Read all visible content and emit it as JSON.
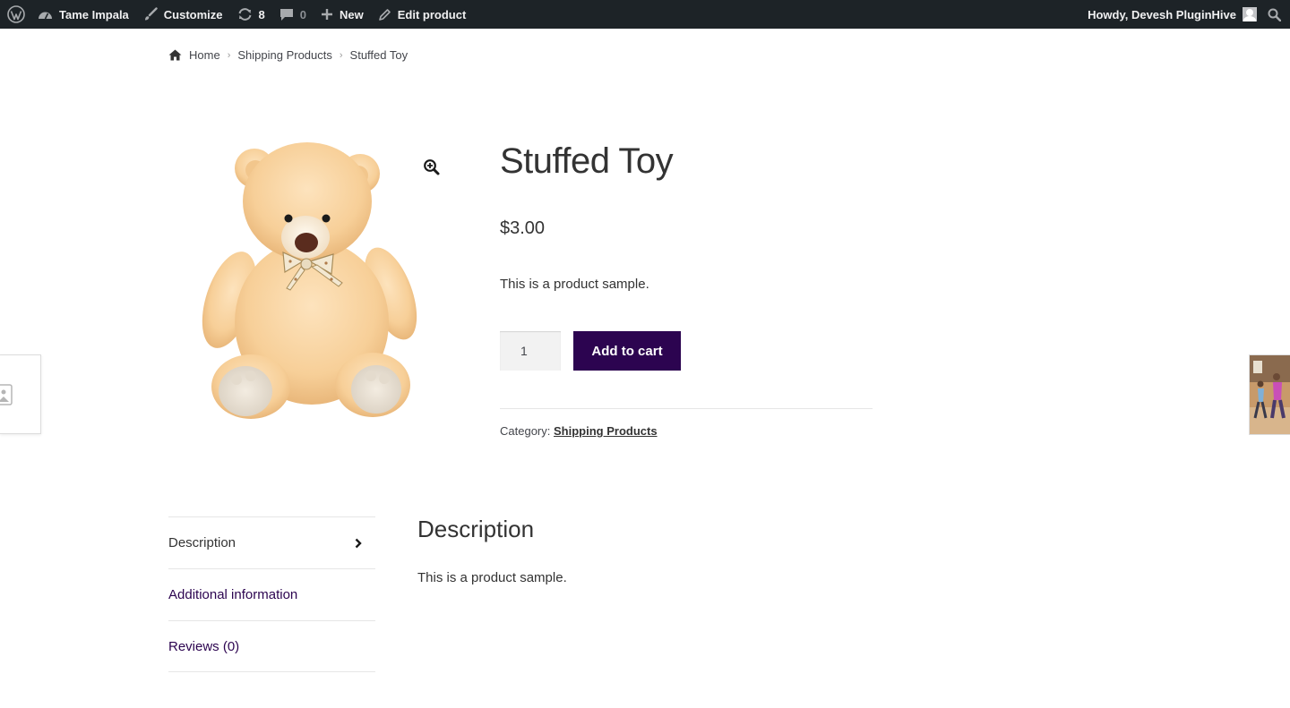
{
  "adminbar": {
    "site_name": "Tame Impala",
    "customize": "Customize",
    "updates_count": "8",
    "comments_count": "0",
    "new_label": "New",
    "edit_label": "Edit product",
    "howdy": "Howdy, Devesh PluginHive"
  },
  "breadcrumb": {
    "home": "Home",
    "category": "Shipping Products",
    "current": "Stuffed Toy"
  },
  "product": {
    "title": "Stuffed Toy",
    "price": "$3.00",
    "short_description": "This is a product sample.",
    "quantity": "1",
    "add_to_cart": "Add to cart",
    "category_label": "Category:",
    "category_link": "Shipping Products"
  },
  "tabs": {
    "items": [
      {
        "label": "Description"
      },
      {
        "label": "Additional information"
      },
      {
        "label": "Reviews (0)"
      }
    ]
  },
  "panel": {
    "title": "Description",
    "text": "This is a product sample."
  },
  "colors": {
    "adminbar_bg": "#1d2327",
    "button_bg": "#2c0450",
    "link_color": "#2c0450"
  }
}
